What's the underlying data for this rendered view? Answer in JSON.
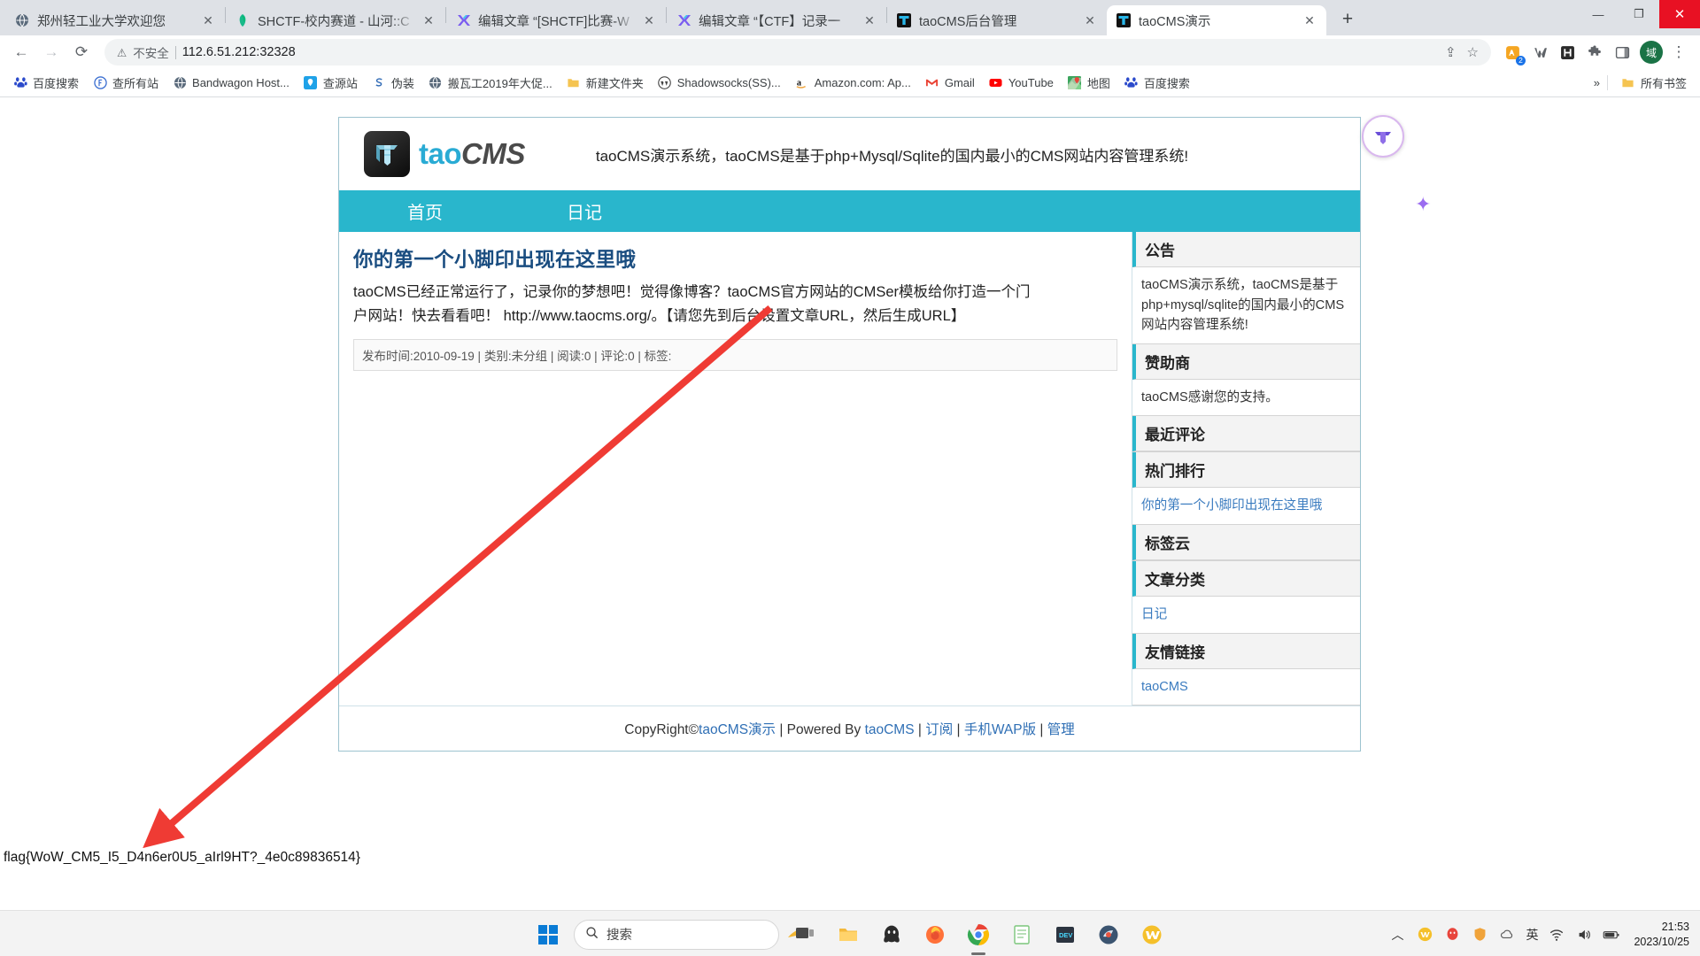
{
  "browser": {
    "tabs": [
      {
        "title": "郑州轻工业大学欢迎您",
        "icon": "globe-icon",
        "active": false
      },
      {
        "title": "SHCTF-校内赛道 - 山河::C",
        "icon": "shctf-icon",
        "active": false
      },
      {
        "title": "编辑文章 “[SHCTF]比赛-W",
        "icon": "editor-icon",
        "active": false
      },
      {
        "title": "编辑文章 “【CTF】记录一",
        "icon": "editor-icon",
        "active": false
      },
      {
        "title": "taoCMS后台管理",
        "icon": "taocms-icon",
        "active": false
      },
      {
        "title": "taoCMS演示",
        "icon": "taocms-icon",
        "active": true
      }
    ],
    "new_tab_label": "+",
    "tab_close_label": "✕",
    "window_controls": {
      "minimize": "—",
      "maximize": "❐",
      "close": "✕"
    },
    "nav": {
      "back": "←",
      "forward": "→",
      "reload": "⟳",
      "security_label": "不安全",
      "security_icon": "warning-triangle-icon",
      "url": "112.6.51.212:32328",
      "share_icon": "share-icon",
      "bookmark_icon": "star-icon",
      "extension_badge": "2",
      "profile_initial": "域",
      "menu_icon": "⋮"
    },
    "bookmarks": [
      {
        "label": "百度搜索",
        "icon": "baidu-icon"
      },
      {
        "label": "查所有站",
        "icon": "f-circle-icon"
      },
      {
        "label": "Bandwagon Host...",
        "icon": "globe-icon"
      },
      {
        "label": "查源站",
        "icon": "location-pin-icon"
      },
      {
        "label": "伪装",
        "icon": "s-icon"
      },
      {
        "label": "搬瓦工2019年大促...",
        "icon": "globe-icon"
      },
      {
        "label": "新建文件夹",
        "icon": "folder-icon"
      },
      {
        "label": "Shadowsocks(SS)...",
        "icon": "wordpress-icon"
      },
      {
        "label": "Amazon.com: Ap...",
        "icon": "amazon-icon"
      },
      {
        "label": "Gmail",
        "icon": "gmail-icon"
      },
      {
        "label": "YouTube",
        "icon": "youtube-icon"
      },
      {
        "label": "地图",
        "icon": "maps-icon"
      },
      {
        "label": "百度搜索",
        "icon": "baidu-icon"
      }
    ],
    "bookmarks_overflow": "»",
    "all_bookmarks_label": "所有书签",
    "all_bookmarks_icon": "folder-icon"
  },
  "site": {
    "logo": {
      "tao": "tao",
      "cms": "CMS"
    },
    "slogan": "taoCMS演示系统，taoCMS是基于php+Mysql/Sqlite的国内最小的CMS网站内容管理系统!",
    "nav": [
      {
        "label": "首页"
      },
      {
        "label": "日记"
      }
    ],
    "article": {
      "title": "你的第一个小脚印出现在这里哦",
      "body_line1": "taoCMS已经正常运行了，记录你的梦想吧！觉得像博客？taoCMS官方网站的CMSer模板给你打造一个门",
      "body_line2": "户网站！快去看看吧！ http://www.taocms.org/。【请您先到后台设置文章URL，然后生成URL】",
      "meta": "发布时间:2010-09-19 | 类别:未分组 | 阅读:0 | 评论:0 | 标签:"
    },
    "sidebar": [
      {
        "title": "公告",
        "body": "taoCMS演示系统，taoCMS是基于php+mysql/sqlite的国内最小的CMS网站内容管理系统!",
        "link": null
      },
      {
        "title": "赞助商",
        "body": "taoCMS感谢您的支持。",
        "link": null
      },
      {
        "title": "最近评论",
        "body": "",
        "link": null
      },
      {
        "title": "热门排行",
        "body": "",
        "link": "你的第一个小脚印出现在这里哦"
      },
      {
        "title": "标签云",
        "body": "",
        "link": null
      },
      {
        "title": "文章分类",
        "body": "",
        "link": "日记"
      },
      {
        "title": "友情链接",
        "body": "",
        "link": "taoCMS"
      }
    ],
    "footer": {
      "prefix": "CopyRight©",
      "link1": "taoCMS演示",
      "mid": " | Powered By ",
      "link2": "taoCMS",
      "sep1": " | ",
      "link3": "订阅",
      "sep2": " | ",
      "link4": "手机WAP版",
      "sep3": " | ",
      "link5": "管理"
    }
  },
  "flag": "flag{WoW_CM5_I5_D4n6er0U5_aIrl9HT?_4e0c89836514}",
  "taskbar": {
    "start_icon": "windows-icon",
    "search_placeholder": "搜索",
    "search_icon": "search-icon",
    "apps": [
      {
        "name": "task-view-icon"
      },
      {
        "name": "file-explorer-icon"
      },
      {
        "name": "qq-icon"
      },
      {
        "name": "firefox-icon"
      },
      {
        "name": "chrome-icon"
      },
      {
        "name": "notepad-icon"
      },
      {
        "name": "dev-tool-icon"
      },
      {
        "name": "browser-icon"
      },
      {
        "name": "wps-icon"
      }
    ],
    "tray": {
      "chevron": "︿",
      "ime": "英",
      "time": "21:53",
      "date": "2023/10/25"
    }
  }
}
